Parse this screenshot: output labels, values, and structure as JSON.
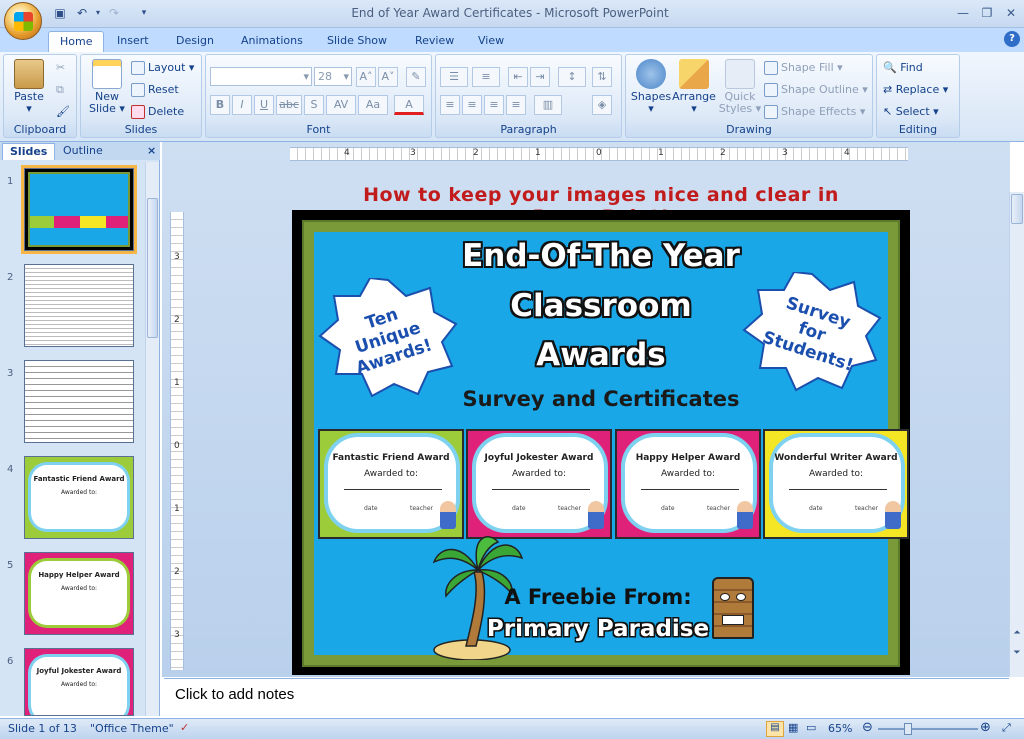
{
  "window": {
    "title": "End of Year Award Certificates - Microsoft PowerPoint"
  },
  "tabs": [
    "Home",
    "Insert",
    "Design",
    "Animations",
    "Slide Show",
    "Review",
    "View"
  ],
  "ribbon": {
    "clipboard": {
      "label": "Clipboard",
      "paste": "Paste"
    },
    "slides": {
      "label": "Slides",
      "new_slide_1": "New",
      "new_slide_2": "Slide",
      "layout": "Layout",
      "reset": "Reset",
      "delete": "Delete"
    },
    "font": {
      "label": "Font",
      "size": "28"
    },
    "paragraph": {
      "label": "Paragraph"
    },
    "drawing": {
      "label": "Drawing",
      "shapes": "Shapes",
      "arrange": "Arrange",
      "quick_styles_1": "Quick",
      "quick_styles_2": "Styles",
      "shape_fill": "Shape Fill",
      "shape_outline": "Shape Outline",
      "shape_effects": "Shape Effects"
    },
    "editing": {
      "label": "Editing",
      "find": "Find",
      "replace": "Replace",
      "select": "Select"
    }
  },
  "left_pane": {
    "tab_slides": "Slides",
    "tab_outline": "Outline",
    "slide_numbers": [
      "1",
      "2",
      "3",
      "4",
      "5",
      "6"
    ],
    "thumb_titles": {
      "t4": "Fantastic Friend Award",
      "t5": "Happy Helper Award",
      "t6": "Joyful Jokester Award",
      "awarded": "Awarded to:"
    }
  },
  "ruler": {
    "h_ticks": [
      "4",
      "3",
      "2",
      "1",
      "0",
      "1",
      "2",
      "3",
      "4"
    ],
    "v_ticks": [
      "3",
      "2",
      "1",
      "0",
      "1",
      "2",
      "3"
    ]
  },
  "slide": {
    "header": "How to keep your images nice and clear in PowerPoint!",
    "title_line1": "End-Of-The Year",
    "title_line2": "Classroom",
    "title_line3": "Awards",
    "subtitle": "Survey and Certificates",
    "badge_left": "Ten Unique Awards!",
    "badge_right": "Survey for Students!",
    "certificates": [
      {
        "title": "Fantastic Friend Award",
        "awarded": "Awarded to:",
        "date": "date",
        "teacher": "teacher",
        "color": "#9ccc3a"
      },
      {
        "title": "Joyful Jokester Award",
        "awarded": "Awarded to:",
        "date": "date",
        "teacher": "teacher",
        "color": "#e0217a"
      },
      {
        "title": "Happy Helper Award",
        "awarded": "Awarded to:",
        "date": "date",
        "teacher": "teacher",
        "color": "#e0217a"
      },
      {
        "title": "Wonderful Writer Award",
        "awarded": "Awarded to:",
        "date": "date",
        "teacher": "teacher",
        "color": "#f5e625"
      }
    ],
    "freebie_line1": "A Freebie From:",
    "freebie_line2": "Primary Paradise"
  },
  "notes": {
    "placeholder": "Click to add notes"
  },
  "status": {
    "slide": "Slide 1 of 13",
    "theme": "\"Office Theme\"",
    "zoom": "65%"
  },
  "colors": {
    "ribbon_text": "#15428b",
    "slide_bg": "#19a7e8",
    "header_red": "#c21b1b"
  }
}
